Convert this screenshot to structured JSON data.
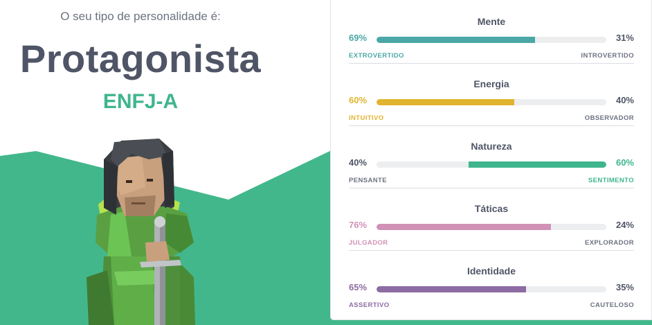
{
  "result": {
    "intro": "O seu tipo de personalidade é:",
    "type_name": "Protagonista",
    "type_code": "ENFJ-A"
  },
  "colors": {
    "background_green": "#43b78c",
    "title_text": "#4f5566",
    "code_green": "#3fb58e"
  },
  "traits": [
    {
      "title": "Mente",
      "left_pct": "69%",
      "right_pct": "31%",
      "left_label": "EXTROVERTIDO",
      "right_label": "INTROVERTIDO",
      "value": 0.69,
      "dominant": "left",
      "color": "#4aa8a6"
    },
    {
      "title": "Energia",
      "left_pct": "60%",
      "right_pct": "40%",
      "left_label": "INTUITIVO",
      "right_label": "OBSERVADOR",
      "value": 0.6,
      "dominant": "left",
      "color": "#e1b430"
    },
    {
      "title": "Natureza",
      "left_pct": "40%",
      "right_pct": "60%",
      "left_label": "PENSANTE",
      "right_label": "SENTIMENTO",
      "value": 0.6,
      "dominant": "right",
      "color": "#3fb58e"
    },
    {
      "title": "Táticas",
      "left_pct": "76%",
      "right_pct": "24%",
      "left_label": "JULGADOR",
      "right_label": "EXPLORADOR",
      "value": 0.76,
      "dominant": "left",
      "color": "#d191b7"
    },
    {
      "title": "Identidade",
      "left_pct": "65%",
      "right_pct": "35%",
      "left_label": "ASSERTIVO",
      "right_label": "CAUTELOSO",
      "value": 0.65,
      "dominant": "left",
      "color": "#8d6ba3"
    }
  ]
}
